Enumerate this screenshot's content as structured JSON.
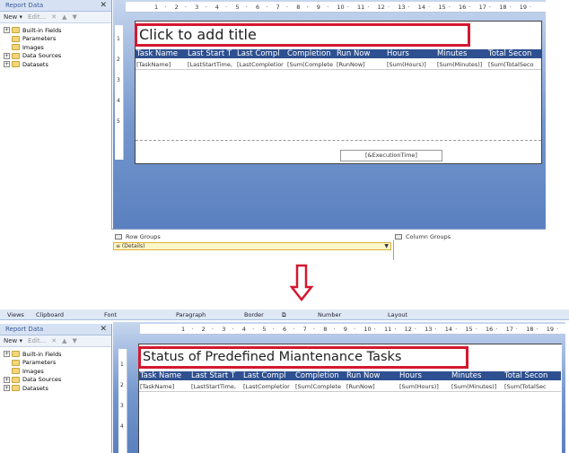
{
  "report_data_pane": {
    "title": "Report Data",
    "close": "✕",
    "toolbar": {
      "new": "New ▾",
      "edit": "Edit...",
      "delete": "✕",
      "up": "▲",
      "down": "▼"
    },
    "items": [
      {
        "label": "Built-in Fields",
        "expander": "+"
      },
      {
        "label": "Parameters",
        "expander": ""
      },
      {
        "label": "Images",
        "expander": ""
      },
      {
        "label": "Data Sources",
        "expander": "+"
      },
      {
        "label": "Datasets",
        "expander": "+"
      }
    ]
  },
  "ruler_ticks": [
    "1",
    "2",
    "3",
    "4",
    "5",
    "6",
    "7",
    "8",
    "9",
    "10",
    "11",
    "12",
    "13",
    "14",
    "15",
    "16",
    "17",
    "18",
    "19"
  ],
  "vruler_ticks": [
    "1",
    "2",
    "3",
    "4",
    "5"
  ],
  "before": {
    "title_placeholder": "Click to add title",
    "headers": [
      "Task Name",
      "Last Start T",
      "Last Compl",
      "Completion",
      "Run Now",
      "Hours",
      "Minutes",
      "Total Secon"
    ],
    "row": [
      "[TaskName]",
      "[LastStartTime,",
      "[LastCompletior",
      "[Sum(Complete",
      "[RunNow]",
      "[Sum(Hours)]",
      "[Sum(Minutes)]",
      "[Sum(TotalSeco"
    ],
    "execution_time": "[&ExecutionTime]",
    "row_groups_label": "Row Groups",
    "column_groups_label": "Column Groups",
    "details_label": "≡ (Details)",
    "details_arrow": "▼"
  },
  "after": {
    "ribbon": [
      "Views",
      "Clipboard",
      "Font",
      "Paragraph",
      "Border",
      "Number",
      "Layout"
    ],
    "ribbon_launcher": "⧉",
    "title": "Status of Predefined Miantenance Tasks",
    "headers": [
      "Task Name",
      "Last Start T",
      "Last Compl",
      "Completion",
      "Run Now",
      "Hours",
      "Minutes",
      "Total Secon"
    ],
    "row": [
      "[TaskName]",
      "[LastStartTime,",
      "[LastCompletior",
      "[Sum(Complete",
      "[RunNow]",
      "[Sum(Hours)]",
      "[Sum(Minutes)]",
      "[Sum(TotalSec"
    ]
  },
  "colors": {
    "header_bg": "#2e5090",
    "highlight": "#d3182f",
    "design_bg": "#7396cd"
  }
}
